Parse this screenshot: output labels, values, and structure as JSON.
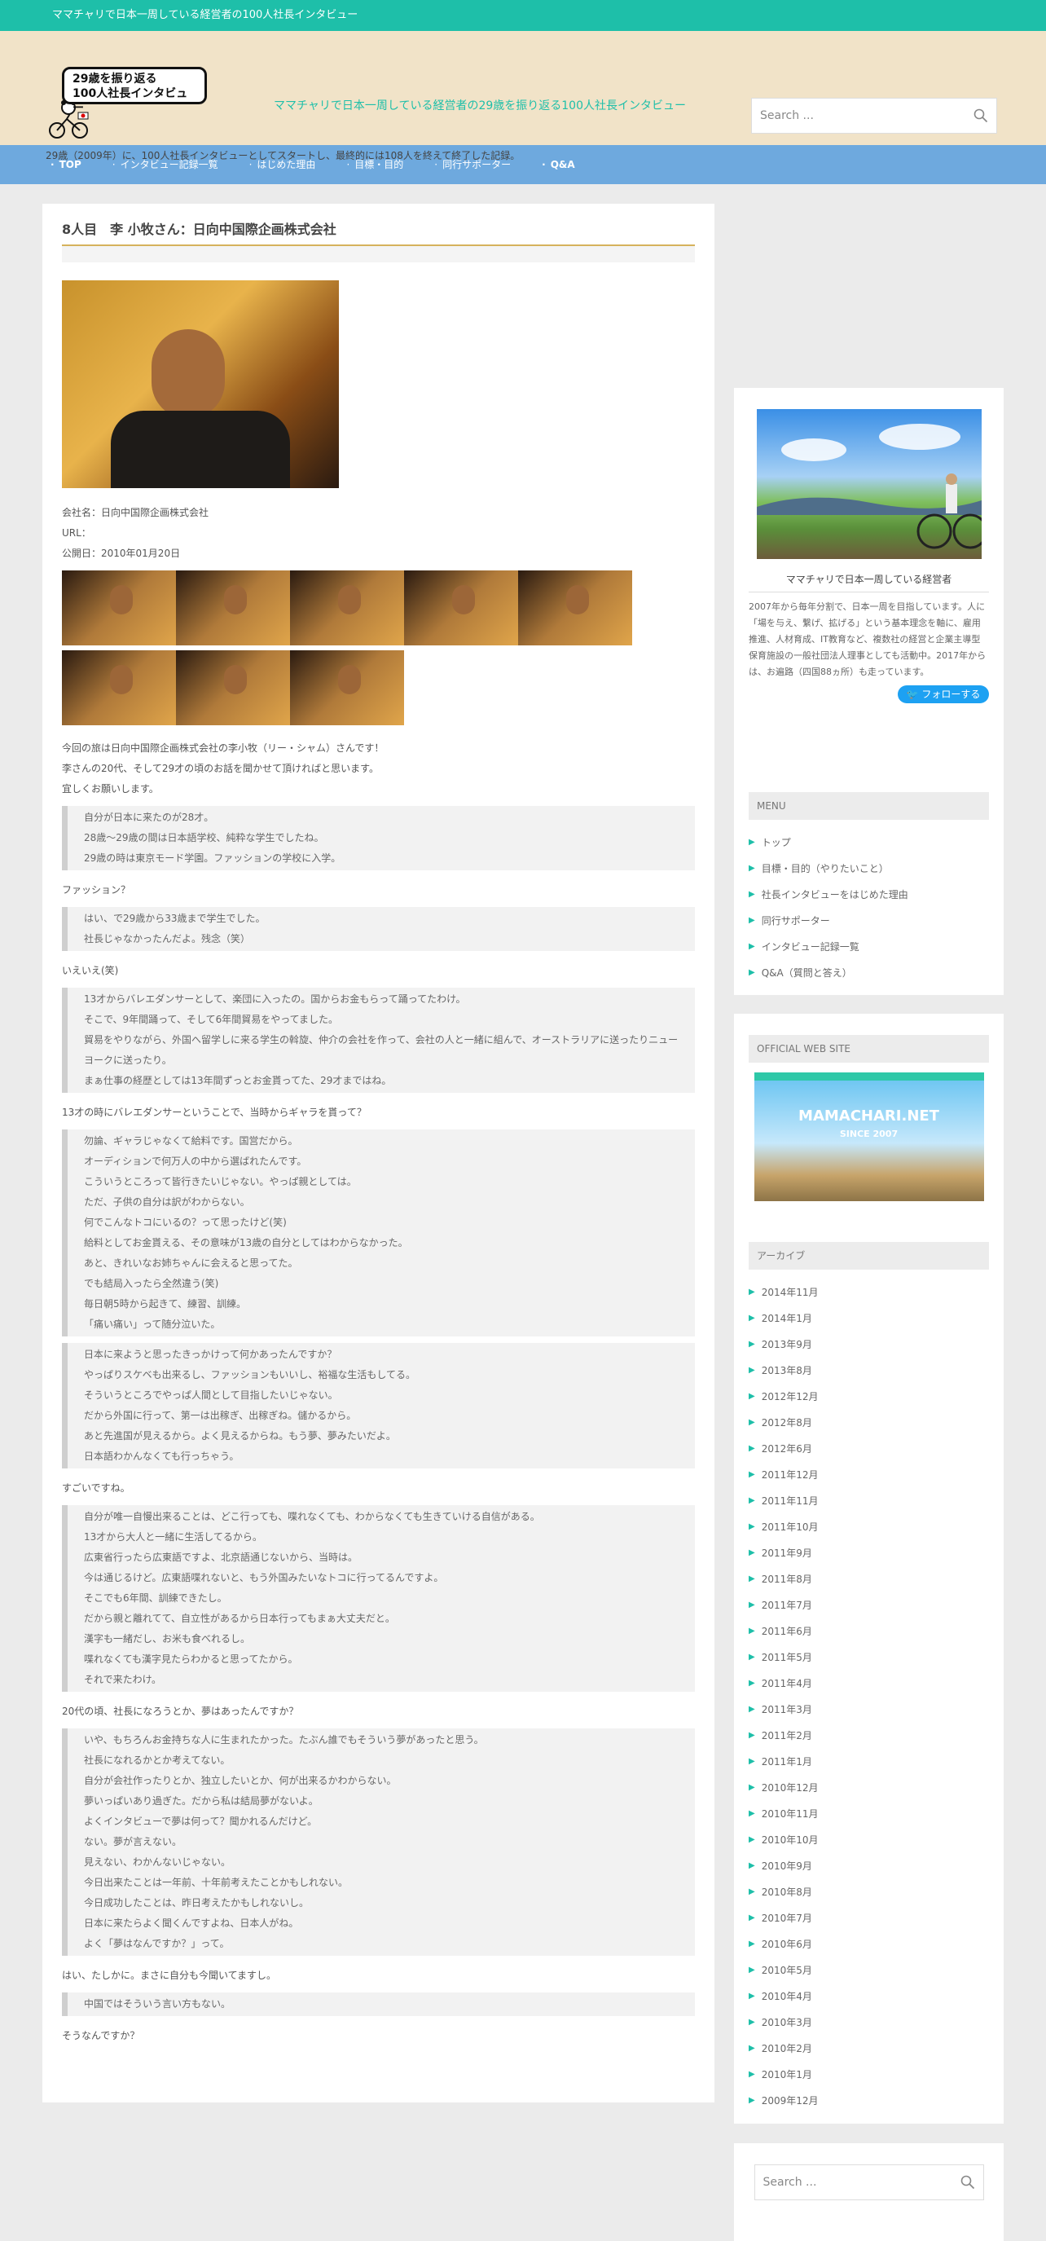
{
  "topbar": {
    "text": "ママチャリで日本一周している経営者の100人社長インタビュー"
  },
  "header": {
    "logo_line1": "29歳を振り返る",
    "logo_line2": "100人社長インタビュー",
    "tagline": "ママチャリで日本一周している経営者の29歳を振り返る100人社長インタビュー",
    "subdesc": "29歳（2009年）に、100人社長インタビューとしてスタートし、最終的には108人を終えて終了した記録。",
    "search_placeholder": "Search ..."
  },
  "nav": [
    {
      "label": "TOP",
      "bold": true
    },
    {
      "label": "インタビュー記録一覧"
    },
    {
      "label": "はじめた理由"
    },
    {
      "label": "目標・目的"
    },
    {
      "label": "同行サポーター"
    },
    {
      "label": "Q&A",
      "bold": true
    }
  ],
  "post": {
    "title_num": "8",
    "title_rest": "人目　李 小牧さん：日向中国際企画株式会社",
    "company": "会社名：日向中国際企画株式会社",
    "url": "URL：",
    "date": "公開日：2010年01月20日",
    "intro": [
      "今回の旅は日向中国際企画株式会社の李小牧（リー・シャム）さんです！",
      "李さんの20代、そして29才の頃のお話を聞かせて頂ければと思います。",
      "宜しくお願いします。"
    ],
    "blocks": [
      {
        "type": "quote",
        "lines": [
          "自分が日本に来たのが28才。",
          "28歳～29歳の間は日本語学校、純粋な学生でしたね。",
          "29歳の時は東京モード学園。ファッションの学校に入学。"
        ]
      },
      {
        "type": "q",
        "lines": [
          "ファッション？"
        ]
      },
      {
        "type": "quote",
        "lines": [
          "はい、で29歳から33歳まで学生でした。",
          "社長じゃなかったんだよ。残念（笑）"
        ]
      },
      {
        "type": "q",
        "lines": [
          "いえいえ(笑)"
        ]
      },
      {
        "type": "quote",
        "lines": [
          "13才からバレエダンサーとして、楽団に入ったの。国からお金もらって踊ってたわけ。",
          "そこで、9年間踊って、そして6年間貿易をやってました。",
          "貿易をやりながら、外国へ留学しに来る学生の斡旋、仲介の会社を作って、会社の人と一緒に組んで、オーストラリアに送ったりニューヨークに送ったり。",
          "まぁ仕事の経歴としては13年間ずっとお金貰ってた、29才まではね。"
        ]
      },
      {
        "type": "q",
        "lines": [
          "13才の時にバレエダンサーということで、当時からギャラを貰って？"
        ]
      },
      {
        "type": "quote",
        "lines": [
          "勿論、ギャラじゃなくて給料です。国営だから。",
          "オーディションで何万人の中から選ばれたんです。",
          "こういうところって皆行きたいじゃない。やっぱ親としては。",
          "ただ、子供の自分は訳がわからない。",
          "何でこんなトコにいるの？って思ったけど(笑)",
          "給料としてお金貰える、その意味が13歳の自分としてはわからなかった。",
          "あと、きれいなお姉ちゃんに会えると思ってた。",
          "でも結局入ったら全然違う(笑)",
          "毎日朝5時から起きて、練習、訓練。",
          "「痛い痛い」って随分泣いた。"
        ]
      },
      {
        "type": "quote",
        "lines": [
          "日本に来ようと思ったきっかけって何かあったんですか？",
          "やっぱりスケベも出来るし、ファッションもいいし、裕福な生活もしてる。",
          "そういうところでやっぱ人間として目指したいじゃない。",
          "だから外国に行って、第一は出稼ぎ、出稼ぎね。儲かるから。",
          "あと先進国が見えるから。よく見えるからね。もう夢、夢みたいだよ。",
          "日本語わかんなくても行っちゃう。"
        ]
      },
      {
        "type": "q",
        "lines": [
          "すごいですね。"
        ]
      },
      {
        "type": "quote",
        "lines": [
          "自分が唯一自慢出来ることは、どこ行っても、喋れなくても、わからなくても生きていける自信がある。",
          "13才から大人と一緒に生活してるから。",
          "広東省行ったら広東語ですよ、北京語通じないから、当時は。",
          "今は通じるけど。広東語喋れないと、もう外国みたいなトコに行ってるんですよ。",
          "そこでも6年間、訓練できたし。",
          "だから親と離れてて、自立性があるから日本行ってもまぁ大丈夫だと。",
          "漢字も一緒だし、お米も食べれるし。",
          "喋れなくても漢字見たらわかると思ってたから。",
          "それで来たわけ。"
        ]
      },
      {
        "type": "q",
        "lines": [
          "20代の頃、社長になろうとか、夢はあったんですか？"
        ]
      },
      {
        "type": "quote",
        "lines": [
          "いや、もちろんお金持ちな人に生まれたかった。たぶん誰でもそういう夢があったと思う。",
          "社長になれるかとか考えてない。",
          "自分が会社作ったりとか、独立したいとか、何が出来るかわからない。",
          "夢いっぱいあり過ぎた。だから私は結局夢がないよ。",
          "よくインタビューで夢は何って？聞かれるんだけど。",
          "ない。夢が言えない。",
          "見えない、わかんないじゃない。",
          "今日出来たことは一年前、十年前考えたことかもしれない。",
          "今日成功したことは、昨日考えたかもしれないし。",
          "日本に来たらよく聞くんですよね、日本人がね。",
          "よく「夢はなんですか？」って。"
        ]
      },
      {
        "type": "q",
        "lines": [
          "はい、たしかに。まさに自分も今聞いてますし。"
        ]
      },
      {
        "type": "quote",
        "lines": [
          "中国ではそういう言い方もない。"
        ]
      },
      {
        "type": "q",
        "lines": [
          "そうなんですか？"
        ]
      }
    ]
  },
  "sidebar": {
    "profile_name": "ママチャリで日本一周している経営者",
    "profile_desc": "2007年から毎年分割で、日本一周を目指しています。人に「場を与え、繋げ、拡げる」という基本理念を軸に、雇用推進、人材育成、IT教育など、複数社の経営と企業主導型保育施設の一般社団法人理事としても活動中。2017年からは、お遍路（四国88ヵ所）も走っています。",
    "follow_label": "フォローする",
    "menu_title": "MENU",
    "menu": [
      "トップ",
      "目標・目的（やりたいこと）",
      "社長インタビューをはじめた理由",
      "同行サポーター",
      "インタビュー記録一覧",
      "Q&A（質問と答え）"
    ],
    "official_title": "OFFICIAL WEB SITE",
    "official_brand": "MAMACHARI.NET",
    "official_since": "SINCE 2007",
    "archive_title": "アーカイブ",
    "archives": [
      "2014年11月",
      "2014年1月",
      "2013年9月",
      "2013年8月",
      "2012年12月",
      "2012年8月",
      "2012年6月",
      "2011年12月",
      "2011年11月",
      "2011年10月",
      "2011年9月",
      "2011年8月",
      "2011年7月",
      "2011年6月",
      "2011年5月",
      "2011年4月",
      "2011年3月",
      "2011年2月",
      "2011年1月",
      "2010年12月",
      "2010年11月",
      "2010年10月",
      "2010年9月",
      "2010年8月",
      "2010年7月",
      "2010年6月",
      "2010年5月",
      "2010年4月",
      "2010年3月",
      "2010年2月",
      "2010年1月",
      "2009年12月"
    ],
    "search_placeholder": "Search ..."
  },
  "colors": {
    "accent": "#1ebfa9",
    "nav": "#6ea9de",
    "header_bg": "#f1e3c8",
    "title_rule": "#d6b25c"
  },
  "icons": {
    "search": "search-icon",
    "twitter": "twitter-icon",
    "bullet": "triangle-bullet-icon"
  }
}
